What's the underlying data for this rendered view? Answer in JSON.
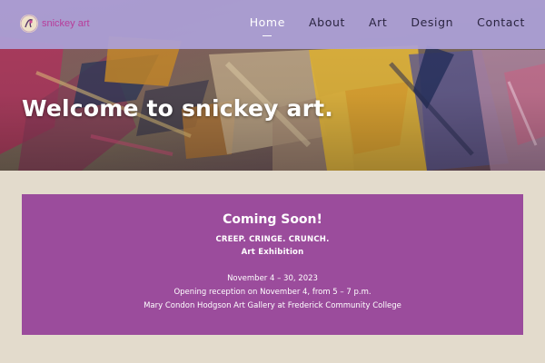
{
  "site": {
    "logo_text": "snickey art",
    "logo_icon": "snickey-logo-icon"
  },
  "nav": {
    "items": [
      {
        "label": "Home",
        "active": true
      },
      {
        "label": "About",
        "active": false
      },
      {
        "label": "Art",
        "active": false
      },
      {
        "label": "Design",
        "active": false
      },
      {
        "label": "Contact",
        "active": false
      }
    ]
  },
  "hero": {
    "title": "Welcome to snickey art."
  },
  "announcement": {
    "heading": "Coming Soon!",
    "subtitle_1": "CREEP. CRINGE. CRUNCH.",
    "subtitle_2": "Art Exhibition",
    "dates": "November 4 – 30, 2023",
    "reception": "Opening reception on November 4, from 5 – 7 p.m.",
    "venue": "Mary Condon Hodgson Art Gallery at Frederick Community College"
  },
  "colors": {
    "header_bg": "#aca0d8",
    "page_bg": "#e3dbcc",
    "panel_bg": "#9b4c9c",
    "logo_accent": "#b83c9a",
    "nav_text": "#2a2440",
    "nav_active": "#ffffff"
  }
}
